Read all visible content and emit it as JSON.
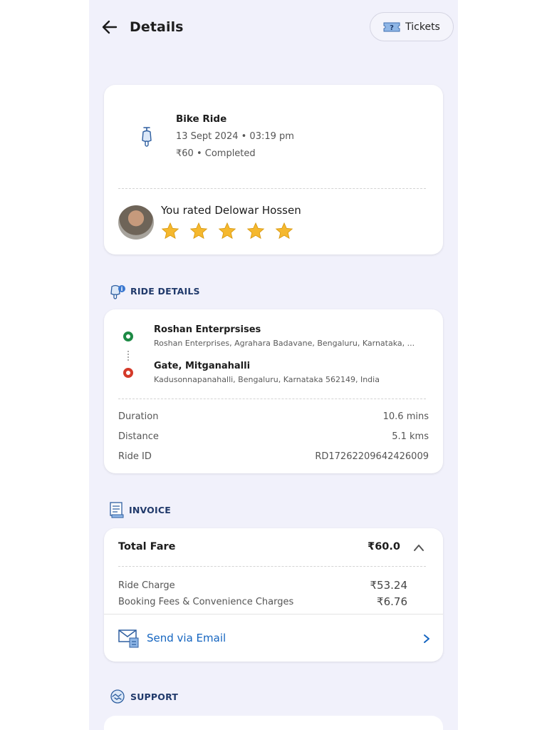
{
  "header": {
    "title": "Details",
    "tickets_label": "Tickets"
  },
  "ride_summary": {
    "ride_type": "Bike Ride",
    "date_time": "13 Sept 2024 • 03:19 pm",
    "fare_status": "₹60 • Completed",
    "rating_text": "You rated Delowar Hossen",
    "rating_stars": 5,
    "rating_max": 5
  },
  "ride_details": {
    "section_label": "RIDE DETAILS",
    "pickup": {
      "name": "Roshan Enterprsises",
      "address": "Roshan Enterprises, Agrahara Badavane, Bengaluru, Karnataka, ..."
    },
    "drop": {
      "name": "Gate, Mitganahalli",
      "address": "Kadusonnapanahalli, Bengaluru, Karnataka 562149, India"
    },
    "info": [
      {
        "label": "Duration",
        "value": "10.6 mins"
      },
      {
        "label": "Distance",
        "value": "5.1 kms"
      },
      {
        "label": "Ride ID",
        "value": "RD17262209642426009"
      }
    ]
  },
  "invoice": {
    "section_label": "INVOICE",
    "total_label": "Total Fare",
    "total_value": "₹60.0",
    "charges": [
      {
        "label": "Ride Charge",
        "value": "₹53.24"
      },
      {
        "label": "Booking Fees & Convenience Charges",
        "value": "₹6.76"
      }
    ],
    "email_label": "Send via Email"
  },
  "support": {
    "section_label": "SUPPORT"
  },
  "colors": {
    "background": "#f1f1fb",
    "section_label": "#213a6b",
    "link": "#1565c0",
    "star": "#f5b82e",
    "pickup_dot": "#1d8a45",
    "drop_dot": "#d43a2a"
  }
}
